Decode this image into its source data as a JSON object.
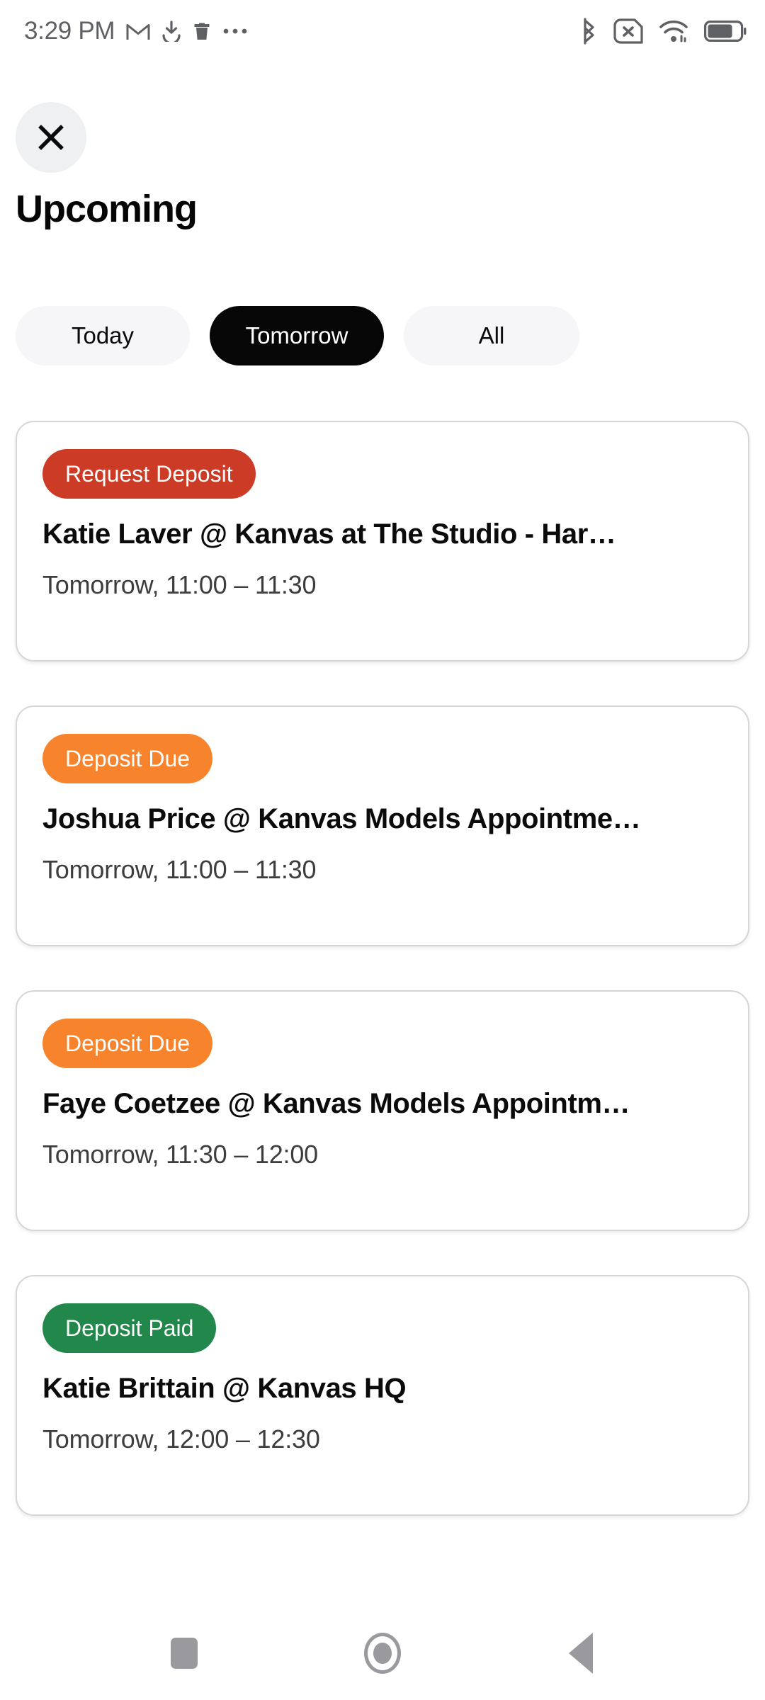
{
  "status_bar": {
    "time": "3:29 PM",
    "left_icons": [
      "gmail-icon",
      "download-icon",
      "trash-icon",
      "more-dots-icon"
    ],
    "right_icons": [
      "bluetooth-icon",
      "no-sim-icon",
      "wifi-icon",
      "battery-icon"
    ],
    "battery_level": "71",
    "icon_color": "#5f6064"
  },
  "header": {
    "close_label": "✕",
    "close_icon": "close-icon",
    "title": "Upcoming"
  },
  "filters": {
    "chips": [
      {
        "label": "Today",
        "selected": false
      },
      {
        "label": "Tomorrow",
        "selected": true
      },
      {
        "label": "All",
        "selected": false
      }
    ],
    "selected_bg": "#060606",
    "unselected_bg": "#f6f6f8"
  },
  "events": [
    {
      "badge": "Request Deposit",
      "badge_color": "#cb3b26",
      "title": "Katie    Laver @ Kanvas at The Studio - Har…",
      "time": "Tomorrow, 11:00 –  11:30"
    },
    {
      "badge": "Deposit Due",
      "badge_color": "#f7842c",
      "title": "Joshua Price @ Kanvas Models Appointme…",
      "time": "Tomorrow, 11:00 –  11:30"
    },
    {
      "badge": "Deposit Due",
      "badge_color": "#f7842c",
      "title": "Faye  Coetzee @ Kanvas Models Appointm…",
      "time": "Tomorrow, 11:30 –  12:00"
    },
    {
      "badge": "Deposit Paid",
      "badge_color": "#21874a",
      "title": "Katie Brittain @ Kanvas HQ",
      "time": "Tomorrow, 12:00 –  12:30"
    }
  ],
  "nav_bar": {
    "recents_icon": "square-recents-icon",
    "home_icon": "circle-home-icon",
    "back_icon": "triangle-back-icon",
    "icon_color": "#9a9a9e"
  }
}
